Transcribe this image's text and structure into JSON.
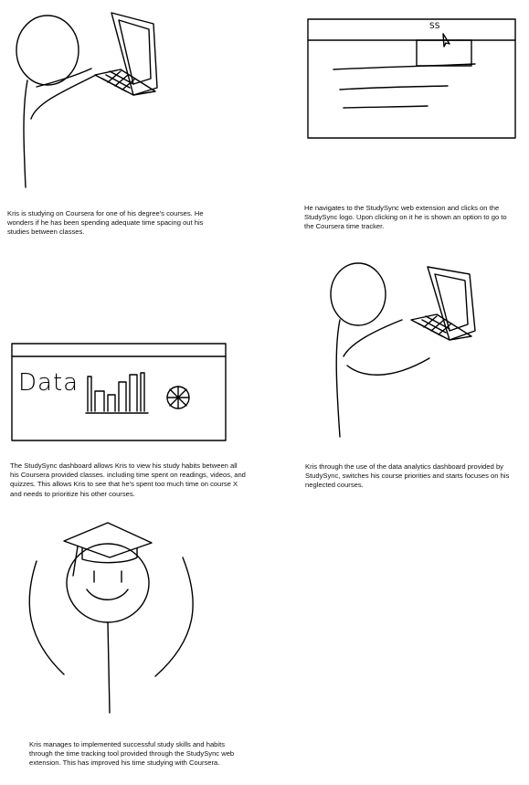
{
  "panels": [
    {
      "caption": "Kris is studying on Coursera for one of his degree's courses. He wonders if he has been spending adequate time spacing out his studies between classes."
    },
    {
      "caption": "He navigates to the StudySync web extension and clicks on the StudySync logo. Upon clicking on it he is shown an option to go to the Coursera time tracker.",
      "logo_text": "SS"
    },
    {
      "caption": "Kris through the use of the data analytics dashboard provided by StudySync, switches his course priorities and starts focuses on his neglected courses."
    },
    {
      "caption": "The StudySync dashboard allows Kris to view his study habits between all his Coursera provided classes. including time spent on readings, videos, and quizzes. This allows Kris to see that he's spent too much time on course X and needs to prioritize his other courses.",
      "dashboard_word": "Data"
    },
    {
      "caption": "Kris manages to implemented successful study skills and habits through the time tracking tool provided through the StudySync web extension. This has improved his time studying with Coursera."
    }
  ]
}
